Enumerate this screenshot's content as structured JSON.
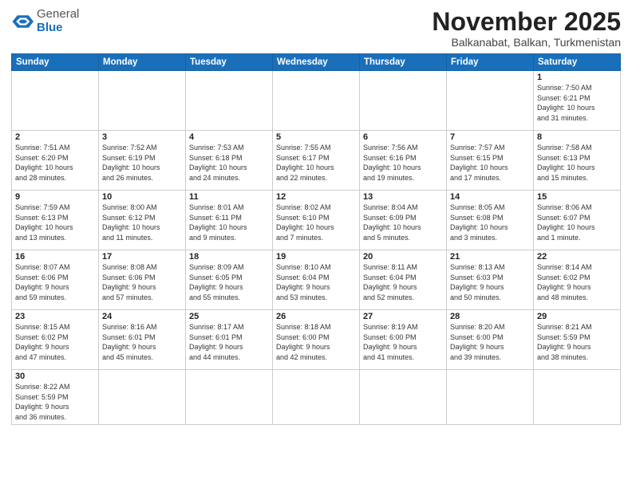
{
  "logo": {
    "general": "General",
    "blue": "Blue"
  },
  "header": {
    "month": "November 2025",
    "location": "Balkanabat, Balkan, Turkmenistan"
  },
  "weekdays": [
    "Sunday",
    "Monday",
    "Tuesday",
    "Wednesday",
    "Thursday",
    "Friday",
    "Saturday"
  ],
  "weeks": [
    [
      {
        "day": "",
        "info": ""
      },
      {
        "day": "",
        "info": ""
      },
      {
        "day": "",
        "info": ""
      },
      {
        "day": "",
        "info": ""
      },
      {
        "day": "",
        "info": ""
      },
      {
        "day": "",
        "info": ""
      },
      {
        "day": "1",
        "info": "Sunrise: 7:50 AM\nSunset: 6:21 PM\nDaylight: 10 hours\nand 31 minutes."
      }
    ],
    [
      {
        "day": "2",
        "info": "Sunrise: 7:51 AM\nSunset: 6:20 PM\nDaylight: 10 hours\nand 28 minutes."
      },
      {
        "day": "3",
        "info": "Sunrise: 7:52 AM\nSunset: 6:19 PM\nDaylight: 10 hours\nand 26 minutes."
      },
      {
        "day": "4",
        "info": "Sunrise: 7:53 AM\nSunset: 6:18 PM\nDaylight: 10 hours\nand 24 minutes."
      },
      {
        "day": "5",
        "info": "Sunrise: 7:55 AM\nSunset: 6:17 PM\nDaylight: 10 hours\nand 22 minutes."
      },
      {
        "day": "6",
        "info": "Sunrise: 7:56 AM\nSunset: 6:16 PM\nDaylight: 10 hours\nand 19 minutes."
      },
      {
        "day": "7",
        "info": "Sunrise: 7:57 AM\nSunset: 6:15 PM\nDaylight: 10 hours\nand 17 minutes."
      },
      {
        "day": "8",
        "info": "Sunrise: 7:58 AM\nSunset: 6:13 PM\nDaylight: 10 hours\nand 15 minutes."
      }
    ],
    [
      {
        "day": "9",
        "info": "Sunrise: 7:59 AM\nSunset: 6:13 PM\nDaylight: 10 hours\nand 13 minutes."
      },
      {
        "day": "10",
        "info": "Sunrise: 8:00 AM\nSunset: 6:12 PM\nDaylight: 10 hours\nand 11 minutes."
      },
      {
        "day": "11",
        "info": "Sunrise: 8:01 AM\nSunset: 6:11 PM\nDaylight: 10 hours\nand 9 minutes."
      },
      {
        "day": "12",
        "info": "Sunrise: 8:02 AM\nSunset: 6:10 PM\nDaylight: 10 hours\nand 7 minutes."
      },
      {
        "day": "13",
        "info": "Sunrise: 8:04 AM\nSunset: 6:09 PM\nDaylight: 10 hours\nand 5 minutes."
      },
      {
        "day": "14",
        "info": "Sunrise: 8:05 AM\nSunset: 6:08 PM\nDaylight: 10 hours\nand 3 minutes."
      },
      {
        "day": "15",
        "info": "Sunrise: 8:06 AM\nSunset: 6:07 PM\nDaylight: 10 hours\nand 1 minute."
      }
    ],
    [
      {
        "day": "16",
        "info": "Sunrise: 8:07 AM\nSunset: 6:06 PM\nDaylight: 9 hours\nand 59 minutes."
      },
      {
        "day": "17",
        "info": "Sunrise: 8:08 AM\nSunset: 6:06 PM\nDaylight: 9 hours\nand 57 minutes."
      },
      {
        "day": "18",
        "info": "Sunrise: 8:09 AM\nSunset: 6:05 PM\nDaylight: 9 hours\nand 55 minutes."
      },
      {
        "day": "19",
        "info": "Sunrise: 8:10 AM\nSunset: 6:04 PM\nDaylight: 9 hours\nand 53 minutes."
      },
      {
        "day": "20",
        "info": "Sunrise: 8:11 AM\nSunset: 6:04 PM\nDaylight: 9 hours\nand 52 minutes."
      },
      {
        "day": "21",
        "info": "Sunrise: 8:13 AM\nSunset: 6:03 PM\nDaylight: 9 hours\nand 50 minutes."
      },
      {
        "day": "22",
        "info": "Sunrise: 8:14 AM\nSunset: 6:02 PM\nDaylight: 9 hours\nand 48 minutes."
      }
    ],
    [
      {
        "day": "23",
        "info": "Sunrise: 8:15 AM\nSunset: 6:02 PM\nDaylight: 9 hours\nand 47 minutes."
      },
      {
        "day": "24",
        "info": "Sunrise: 8:16 AM\nSunset: 6:01 PM\nDaylight: 9 hours\nand 45 minutes."
      },
      {
        "day": "25",
        "info": "Sunrise: 8:17 AM\nSunset: 6:01 PM\nDaylight: 9 hours\nand 44 minutes."
      },
      {
        "day": "26",
        "info": "Sunrise: 8:18 AM\nSunset: 6:00 PM\nDaylight: 9 hours\nand 42 minutes."
      },
      {
        "day": "27",
        "info": "Sunrise: 8:19 AM\nSunset: 6:00 PM\nDaylight: 9 hours\nand 41 minutes."
      },
      {
        "day": "28",
        "info": "Sunrise: 8:20 AM\nSunset: 6:00 PM\nDaylight: 9 hours\nand 39 minutes."
      },
      {
        "day": "29",
        "info": "Sunrise: 8:21 AM\nSunset: 5:59 PM\nDaylight: 9 hours\nand 38 minutes."
      }
    ],
    [
      {
        "day": "30",
        "info": "Sunrise: 8:22 AM\nSunset: 5:59 PM\nDaylight: 9 hours\nand 36 minutes."
      },
      {
        "day": "",
        "info": ""
      },
      {
        "day": "",
        "info": ""
      },
      {
        "day": "",
        "info": ""
      },
      {
        "day": "",
        "info": ""
      },
      {
        "day": "",
        "info": ""
      },
      {
        "day": "",
        "info": ""
      }
    ]
  ]
}
